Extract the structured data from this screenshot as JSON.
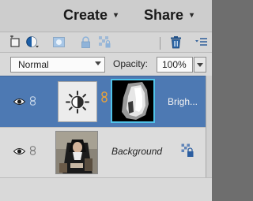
{
  "header": {
    "create_label": "Create",
    "share_label": "Share",
    "dropdown_arrow": "▾"
  },
  "toolbar": {
    "icons": [
      "new-layer-icon",
      "fill-adjustment-icon",
      "add-mask-icon",
      "lock-icon",
      "lock-transparency-icon",
      "trash-icon",
      "panel-menu-icon"
    ]
  },
  "blend": {
    "mode": "Normal",
    "opacity_label": "Opacity:",
    "opacity_value": "100%"
  },
  "layers": [
    {
      "name": "Brigh...",
      "type": "adjustment",
      "adjustment_icon": "brightness-contrast-icon",
      "visible": true,
      "selected": true
    },
    {
      "name": "Background",
      "type": "image",
      "visible": true,
      "locked": true,
      "selected": false
    }
  ],
  "colors": {
    "selected_row": "#4d79b3",
    "mask_border": "#4fc3ea",
    "header_bg": "#cdcdcd",
    "panel_bg": "#d9d9d9"
  }
}
